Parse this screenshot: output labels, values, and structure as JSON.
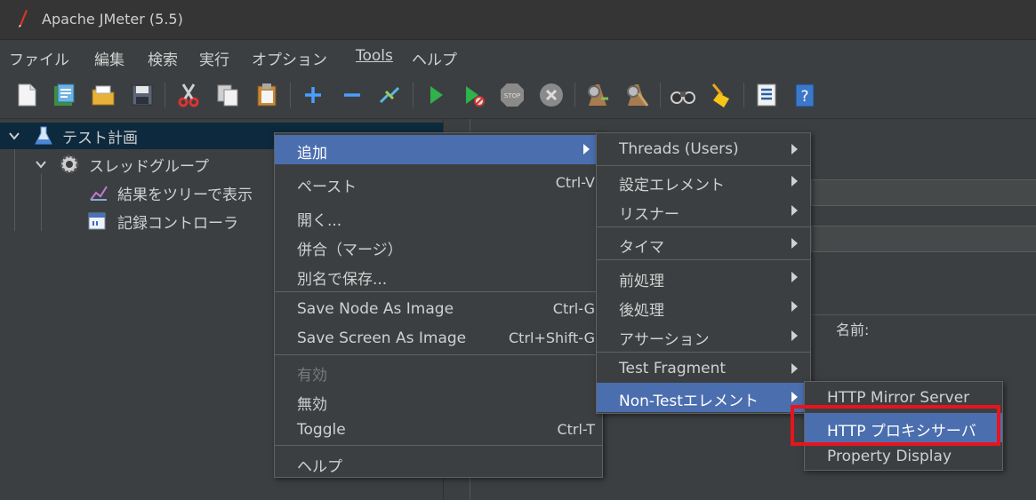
{
  "window": {
    "title": "Apache JMeter (5.5)"
  },
  "menubar": [
    "ファイル",
    "編集",
    "検索",
    "実行",
    "オプション",
    "Tools",
    "ヘルプ"
  ],
  "toolbar": {
    "icons": [
      "new-icon",
      "templates-icon",
      "open-icon",
      "save-icon",
      "cut-icon",
      "copy-icon",
      "paste-icon",
      "expand-icon",
      "collapse-icon",
      "toggle-icon",
      "start-icon",
      "start-no-pause-icon",
      "stop-icon",
      "shutdown-icon",
      "remote-start-icon",
      "remote-clear-icon",
      "search-icon",
      "clear-all-icon",
      "function-helper-icon",
      "help-icon"
    ]
  },
  "tree": {
    "test_plan": "テスト計画",
    "thread_group": "スレッドグループ",
    "view_results_tree": "結果をツリーで表示",
    "recording_controller": "記録コントローラ"
  },
  "right_panel": {
    "name_label": "名前:"
  },
  "context_menu": {
    "items": [
      {
        "label": "追加",
        "accel": "",
        "submenu": true
      },
      {
        "label": "ペースト",
        "accel": "Ctrl-V"
      },
      {
        "label": "開く...",
        "accel": ""
      },
      {
        "label": "併合（マージ）",
        "accel": ""
      },
      {
        "label": "別名で保存...",
        "accel": ""
      },
      {
        "label": "Save Node As Image",
        "accel": "Ctrl-G"
      },
      {
        "label": "Save Screen As Image",
        "accel": "Ctrl+Shift-G"
      },
      {
        "label": "有効",
        "accel": ""
      },
      {
        "label": "無効",
        "accel": ""
      },
      {
        "label": "Toggle",
        "accel": "Ctrl-T"
      },
      {
        "label": "ヘルプ",
        "accel": ""
      }
    ]
  },
  "add_submenu": {
    "items": [
      "Threads (Users)",
      "設定エレメント",
      "リスナー",
      "タイマ",
      "前処理",
      "後処理",
      "アサーション",
      "Test Fragment",
      "Non-Testエレメント"
    ]
  },
  "non_test_submenu": {
    "items": [
      "HTTP Mirror Server",
      "HTTP プロキシサーバ",
      "Property Display"
    ]
  },
  "colors": {
    "highlight": "#4b6eaf",
    "annotation": "#e8141c",
    "background": "#3c3f41"
  }
}
